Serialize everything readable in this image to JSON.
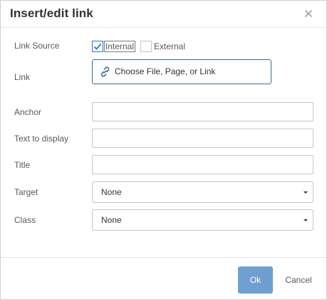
{
  "dialog": {
    "title": "Insert/edit link",
    "close_icon": "close-icon"
  },
  "link_source": {
    "label": "Link Source",
    "options": [
      {
        "label": "Internal",
        "checked": true
      },
      {
        "label": "External",
        "checked": false
      }
    ]
  },
  "link": {
    "label": "Link",
    "button_label": "Choose File, Page, or Link",
    "button_icon": "link-icon"
  },
  "fields": {
    "anchor": {
      "label": "Anchor",
      "value": ""
    },
    "text_to_display": {
      "label": "Text to display",
      "value": ""
    },
    "title": {
      "label": "Title",
      "value": ""
    }
  },
  "selects": {
    "target": {
      "label": "Target",
      "value": "None"
    },
    "class": {
      "label": "Class",
      "value": "None"
    }
  },
  "footer": {
    "ok_label": "Ok",
    "cancel_label": "Cancel"
  },
  "colors": {
    "primary": "#6f9fd0",
    "link_border": "#2f6d9e",
    "check": "#2276d2"
  }
}
